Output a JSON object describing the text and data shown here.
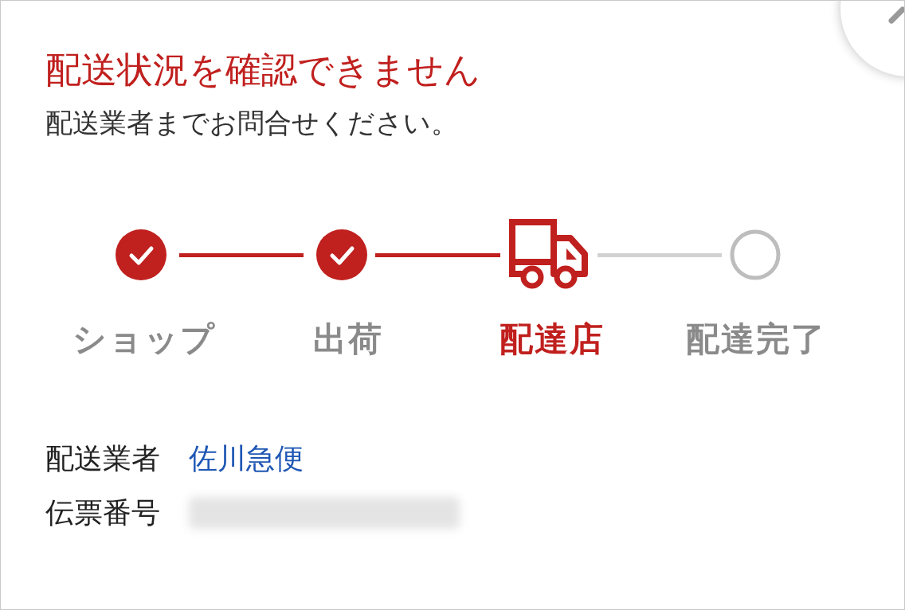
{
  "title": "配送状況を確認できません",
  "subtitle": "配送業者までお問合せください。",
  "steps": [
    {
      "label": "ショップ",
      "reached": true,
      "current": false,
      "kind": "circle"
    },
    {
      "label": "出荷",
      "reached": true,
      "current": false,
      "kind": "circle"
    },
    {
      "label": "配達店",
      "reached": true,
      "current": true,
      "kind": "truck"
    },
    {
      "label": "配達完了",
      "reached": false,
      "current": false,
      "kind": "circle"
    }
  ],
  "details": [
    {
      "label": "配送業者",
      "value": "佐川急便",
      "kind": "link"
    },
    {
      "label": "伝票番号",
      "kind": "redacted"
    }
  ]
}
